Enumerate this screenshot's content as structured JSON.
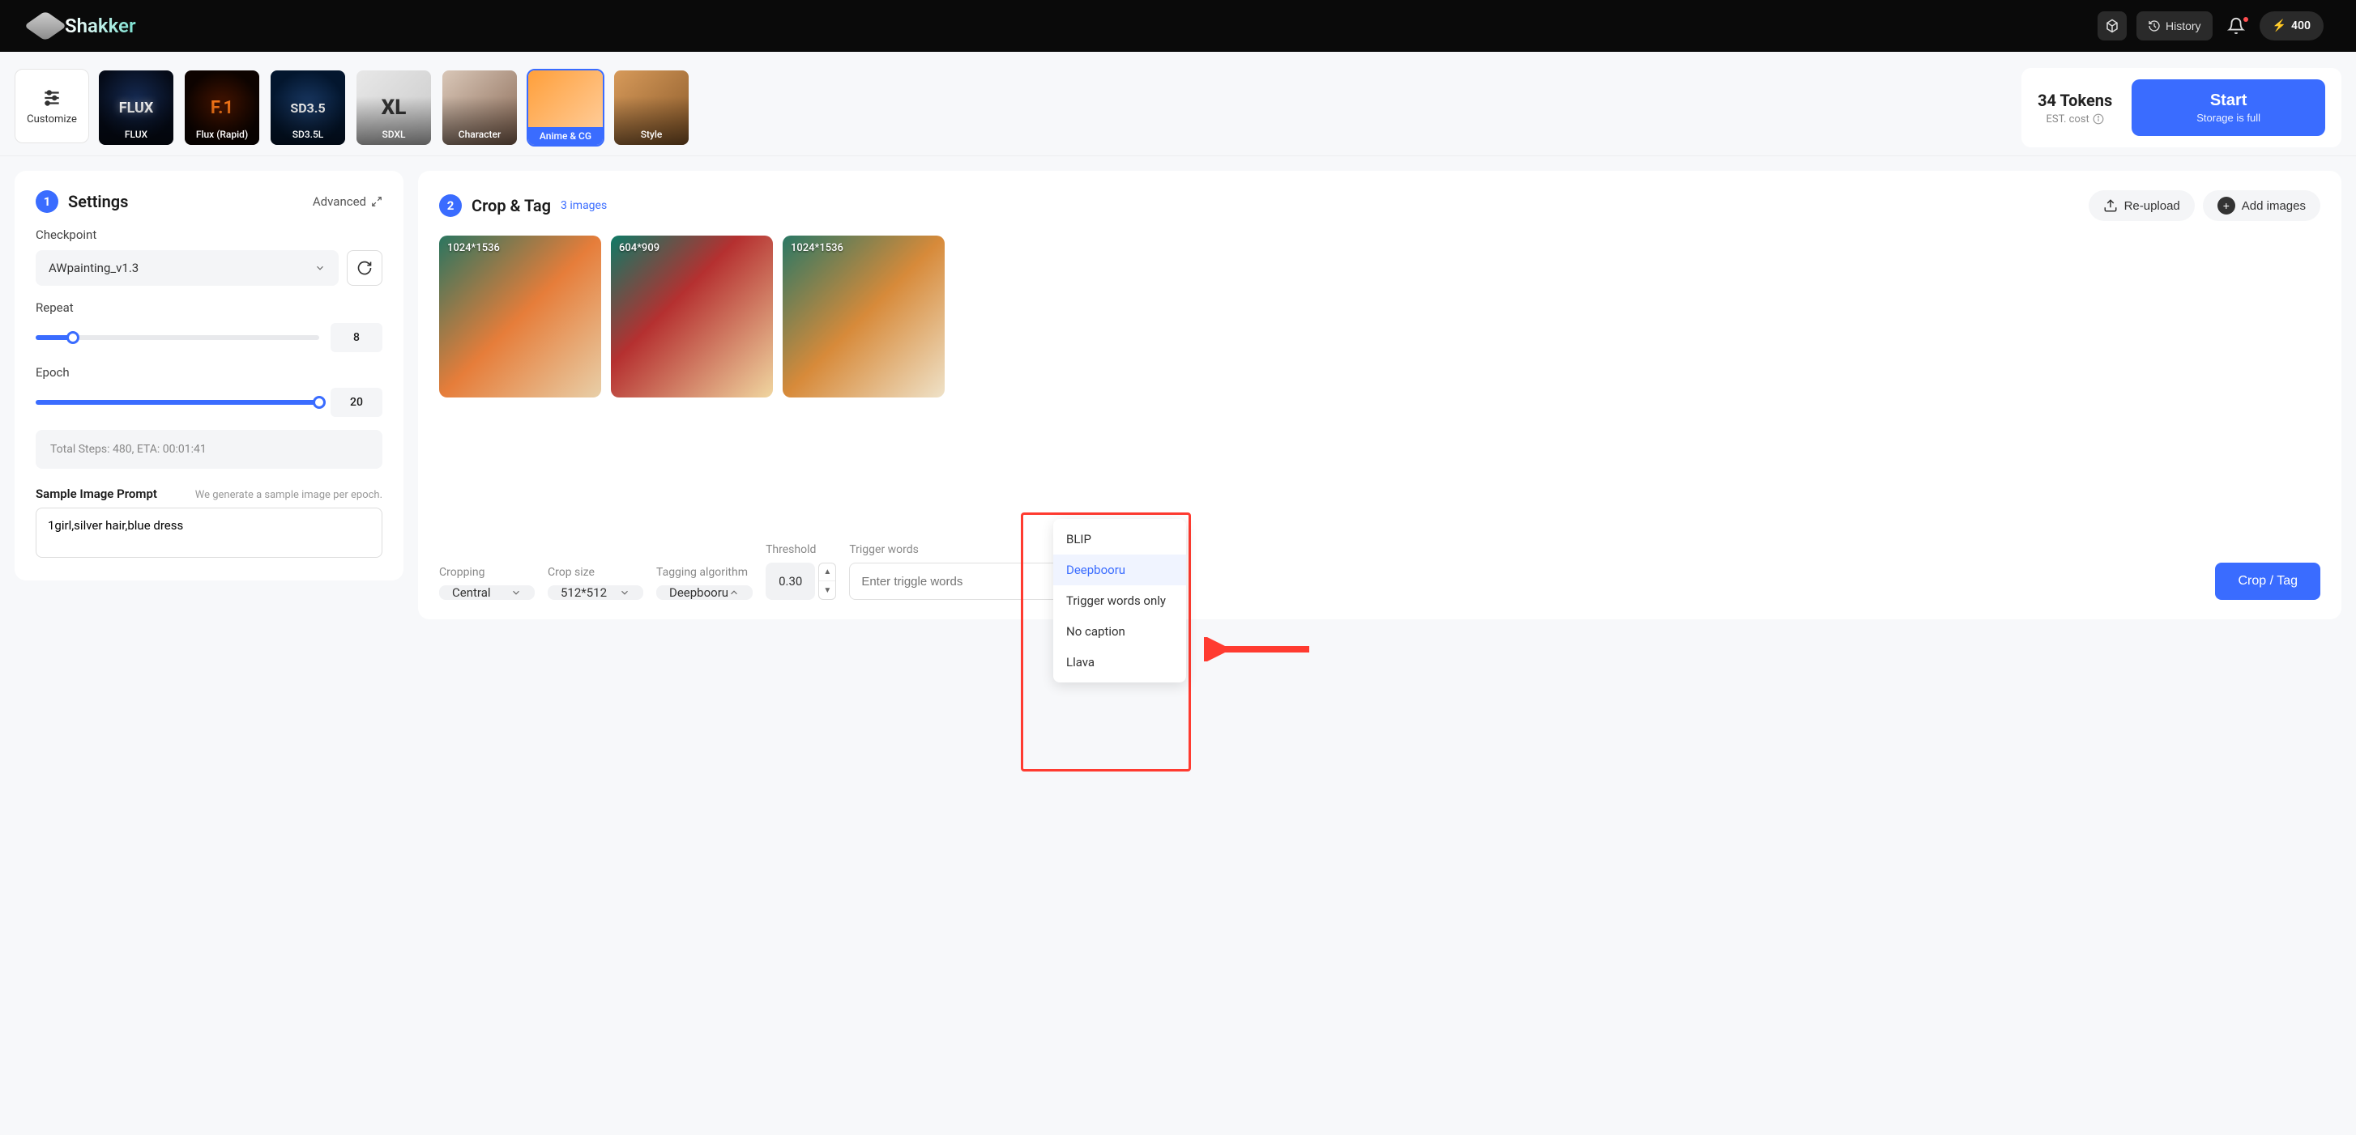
{
  "header": {
    "logo_text": "Shakker",
    "history_label": "History",
    "credits": "400"
  },
  "categories": {
    "customize_label": "Customize",
    "items": [
      {
        "label": "FLUX",
        "cls": "t-flux",
        "txt": "FLUX"
      },
      {
        "label": "Flux (Rapid)",
        "cls": "t-f1",
        "txt": "F.1"
      },
      {
        "label": "SD3.5L",
        "cls": "t-sd35",
        "txt": "SD3.5"
      },
      {
        "label": "SDXL",
        "cls": "t-sdxl",
        "txt": "XL"
      },
      {
        "label": "Character",
        "cls": "t-char",
        "txt": ""
      },
      {
        "label": "Anime & CG",
        "cls": "t-anime",
        "txt": "",
        "selected": true
      },
      {
        "label": "Style",
        "cls": "t-style",
        "txt": ""
      }
    ]
  },
  "tokens": {
    "count": "34 Tokens",
    "est": "EST. cost"
  },
  "start": {
    "title": "Start",
    "sub": "Storage is full"
  },
  "settings": {
    "title": "Settings",
    "step": "1",
    "advanced": "Advanced",
    "checkpoint_label": "Checkpoint",
    "checkpoint_value": "AWpainting_v1.3",
    "repeat_label": "Repeat",
    "repeat_value": "8",
    "repeat_pct": 13,
    "epoch_label": "Epoch",
    "epoch_value": "20",
    "epoch_pct": 100,
    "info": "Total Steps: 480,  ETA: 00:01:41",
    "prompt_title": "Sample Image Prompt",
    "prompt_hint": "We generate a sample image per epoch.",
    "prompt_value": "1girl,silver hair,blue dress"
  },
  "crop": {
    "step": "2",
    "title": "Crop & Tag",
    "count": "3 images",
    "reupload": "Re-upload",
    "add_images": "Add images",
    "images": [
      {
        "dim": "1024*1536",
        "cls": "ic1"
      },
      {
        "dim": "604*909",
        "cls": "ic2"
      },
      {
        "dim": "1024*1536",
        "cls": "ic3"
      }
    ],
    "dropdown_options": [
      "BLIP",
      "Deepbooru",
      "Trigger words only",
      "No caption",
      "Llava"
    ],
    "controls": {
      "cropping_label": "Cropping",
      "cropping_value": "Central",
      "cropsize_label": "Crop size",
      "cropsize_value": "512*512",
      "algo_label": "Tagging algorithm",
      "algo_value": "Deepbooru",
      "thresh_label": "Threshold",
      "thresh_value": "0.30",
      "trigger_label": "Trigger words",
      "trigger_placeholder": "Enter triggle words",
      "action": "Crop / Tag"
    }
  }
}
